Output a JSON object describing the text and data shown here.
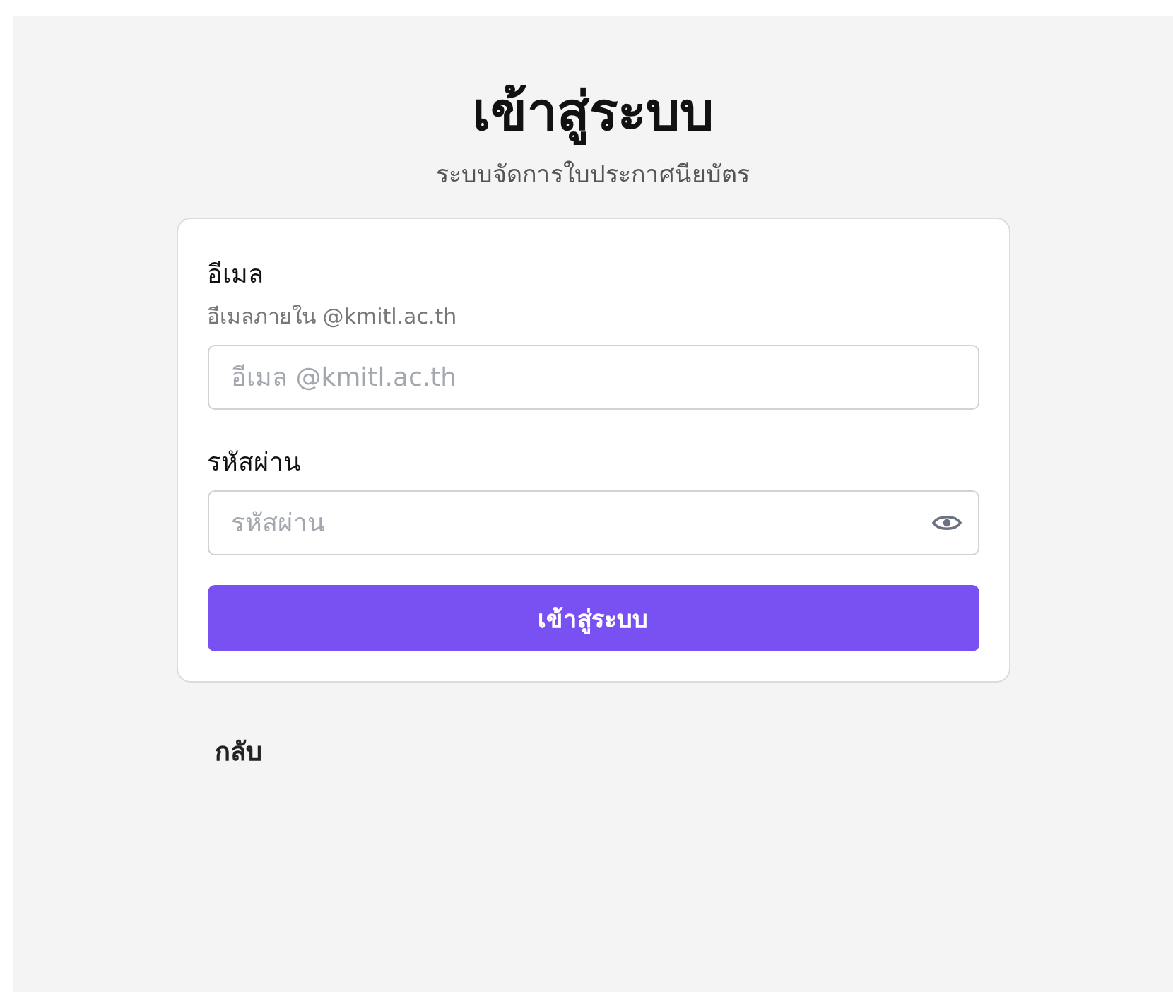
{
  "title": "เข้าสู่ระบบ",
  "subtitle": "ระบบจัดการใบประกาศนียบัตร",
  "form": {
    "fields": [
      {
        "kind": "email",
        "label": "อีเมล",
        "hint": "อีเมลภายใน @kmitl.ac.th",
        "placeholder": "อีเมล @kmitl.ac.th"
      },
      {
        "kind": "password",
        "label": "รหัสผ่าน",
        "placeholder": "รหัสผ่าน"
      }
    ],
    "submit": "เข้าสู่ระบบ"
  },
  "back_link": "กลับ"
}
